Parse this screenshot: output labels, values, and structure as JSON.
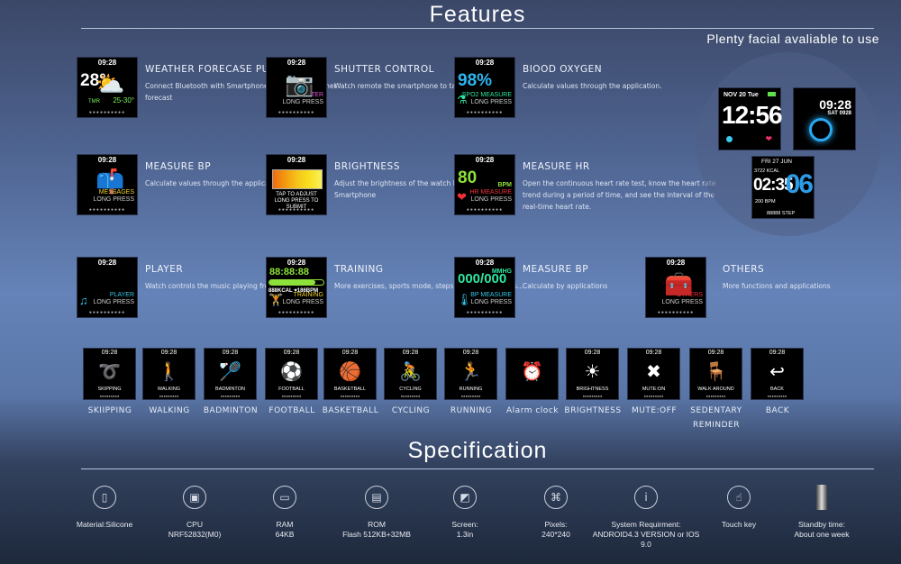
{
  "features": {
    "title": "Features",
    "faces_caption": "Plenty facial avaliable to use",
    "cards": [
      {
        "title": "WEATHER FORECASE PUSH",
        "desc": "Connect Bluetooth with Smartphoneto push the weather forecast",
        "time": "09:28",
        "big": "28°",
        "l1": "25-30°",
        "l2": "TMR",
        "icon": "weather-cloud-icon",
        "glyph": "⛅",
        "color": "#7cf05a"
      },
      {
        "title": "SHUTTER CONTROL",
        "desc": "Watch remote the smartphone to take photos.",
        "time": "09:28",
        "big": "",
        "l1": "SHUTTER",
        "l2": "LONG PRESS",
        "icon": "camera-icon",
        "glyph": "📷",
        "color": "#e84fe0"
      },
      {
        "title": "BIOOD OXYGEN",
        "desc": "Calculate values through the application.",
        "time": "09:28",
        "big": "98%",
        "l1": "SPO2 MEASURE",
        "l2": "LONG PRESS",
        "icon": "flask-icon",
        "glyph": "⚗",
        "color": "#2ee6a0",
        "bigcolor": "#2bb6f0"
      },
      {
        "title": "MEASURE BP",
        "desc": "Calculate values through the application",
        "time": "09:28",
        "big": "",
        "l1": "MESSAGES",
        "l2": "LONG PRESS",
        "icon": "mailbox-icon",
        "glyph": "📫",
        "color": "#f2d22a"
      },
      {
        "title": "BRIGHTNESS",
        "desc": "Adjust the brightness of the watch by connecting the Smartphone",
        "time": "09:28",
        "big": "",
        "l1": "TAP TO ADJUST",
        "l2": "LONG PRESS TO SUBMIT",
        "icon": "brightness-bar-icon",
        "glyph": "",
        "color": "#ffffff"
      },
      {
        "title": "MEASURE HR",
        "desc": "Open the continuous heart rate test, know the heart rate trend during a period of time, and see the interval of the real-time heart rate.",
        "time": "09:28",
        "big": "80",
        "l1": "HR MEASURE",
        "l2": "LONG PRESS",
        "icon": "heart-icon",
        "glyph": "❤",
        "color": "#f0303a",
        "bigcolor": "#8ee03a",
        "unit": "BPM"
      },
      {
        "title": "PLAYER",
        "desc": "Watch controls the music playing from， Smartphone",
        "time": "09:28",
        "big": "",
        "l1": "PLAYER",
        "l2": "LONG PRESS",
        "icon": "music-player-icon",
        "glyph": "♫",
        "color": "#34c6e8"
      },
      {
        "title": "TRAINING",
        "desc": "More exercises, sports mode, steps, distance, calories...",
        "time": "09:28",
        "big": "88:88:88",
        "l1": "TRAINING",
        "l2": "LONG PRESS",
        "icon": "dumbbell-icon",
        "glyph": "🏋",
        "color": "#f2d22a",
        "bigcolor": "#8ee03a",
        "sub": "888KCAL ♥186BPM"
      },
      {
        "title": "MEASURE BP",
        "desc": "Calculate by applications",
        "time": "09:28",
        "big": "000/000",
        "l1": "BP MEASURE",
        "l2": "LONG PRESS",
        "icon": "thermometer-icon",
        "glyph": "🌡",
        "color": "#34c6e8",
        "bigcolor": "#2ee6a0",
        "unit": "MMHG"
      },
      {
        "title": "OTHERS",
        "desc": "More functions and applications",
        "time": "09:28",
        "big": "",
        "l1": "OTHERS",
        "l2": "LONG PRESS",
        "icon": "toolbox-icon",
        "glyph": "🧰",
        "color": "#f0303a"
      }
    ],
    "faces": [
      {
        "date": "NOV 20  Tue",
        "time": "12:56"
      },
      {
        "date": "SAT 0928",
        "time": "09:28"
      },
      {
        "date": "FRI 27 JUN",
        "time": "02:35",
        "sec": "06",
        "kcal": "3722 KCAL",
        "bpm": "200 BPM",
        "step": "88888 STEP"
      }
    ]
  },
  "sports": [
    {
      "screen": "SKIPPING",
      "label": "SKIIPPING",
      "glyph": "➰",
      "icon": "jump-rope-icon"
    },
    {
      "screen": "WALKING",
      "label": "WALKING",
      "glyph": "🚶",
      "icon": "walking-icon"
    },
    {
      "screen": "BADMINTON",
      "label": "BADMINTON",
      "glyph": "🏸",
      "icon": "shuttlecock-icon"
    },
    {
      "screen": "FOOTBALL",
      "label": "FOOTBALL",
      "glyph": "⚽",
      "icon": "football-icon"
    },
    {
      "screen": "BASKETBALL",
      "label": "BASKETBALL",
      "glyph": "🏀",
      "icon": "basketball-icon"
    },
    {
      "screen": "CYCLING",
      "label": "CYCLING",
      "glyph": "🚴",
      "icon": "cycling-icon"
    },
    {
      "screen": "RUNNING",
      "label": "RUNNING",
      "glyph": "🏃",
      "icon": "running-icon"
    },
    {
      "screen": "",
      "label": "Alarm clock",
      "glyph": "⏰",
      "icon": "alarm-clock-icon"
    },
    {
      "screen": "BRIGHTNESS",
      "label": "BRIGHTNESS",
      "glyph": "☀",
      "icon": "sun-icon"
    },
    {
      "screen": "MUTE:ON",
      "label": "MUTE:OFF",
      "glyph": "✖",
      "icon": "mute-icon"
    },
    {
      "screen": "WALK AROUND",
      "label": "SEDENTARY REMINDER",
      "glyph": "🪑",
      "icon": "armchair-icon"
    },
    {
      "screen": "BACK",
      "label": "BACK",
      "glyph": "↩",
      "icon": "back-arrow-icon"
    }
  ],
  "sport_time": "09:28",
  "spec": {
    "title": "Specification",
    "items": [
      {
        "l1": "Material:Silicone",
        "l2": "",
        "icon": "phone-material-icon",
        "glyph": "▯"
      },
      {
        "l1": "CPU",
        "l2": "NRF52832(M0)",
        "icon": "chip-icon",
        "glyph": "▣"
      },
      {
        "l1": "RAM",
        "l2": "64KB",
        "icon": "ram-icon",
        "glyph": "▭"
      },
      {
        "l1": "ROM",
        "l2": "Flash 512KB+32MB",
        "icon": "sd-card-icon",
        "glyph": "▤"
      },
      {
        "l1": "Screen:",
        "l2": "1.3in",
        "icon": "screen-icon",
        "glyph": "◩"
      },
      {
        "l1": "Pixels:",
        "l2": "240*240",
        "icon": "pixels-icon",
        "glyph": "⌘"
      },
      {
        "l1": "System Requirment:",
        "l2": "ANDROID4.3 VERSION or IOS 9.0",
        "icon": "info-icon",
        "glyph": "i"
      },
      {
        "l1": "Touch key",
        "l2": "",
        "icon": "touch-hand-icon",
        "glyph": "☝"
      },
      {
        "l1": "Standby time:",
        "l2": "About one week",
        "icon": "battery-icon",
        "glyph": ""
      }
    ]
  }
}
